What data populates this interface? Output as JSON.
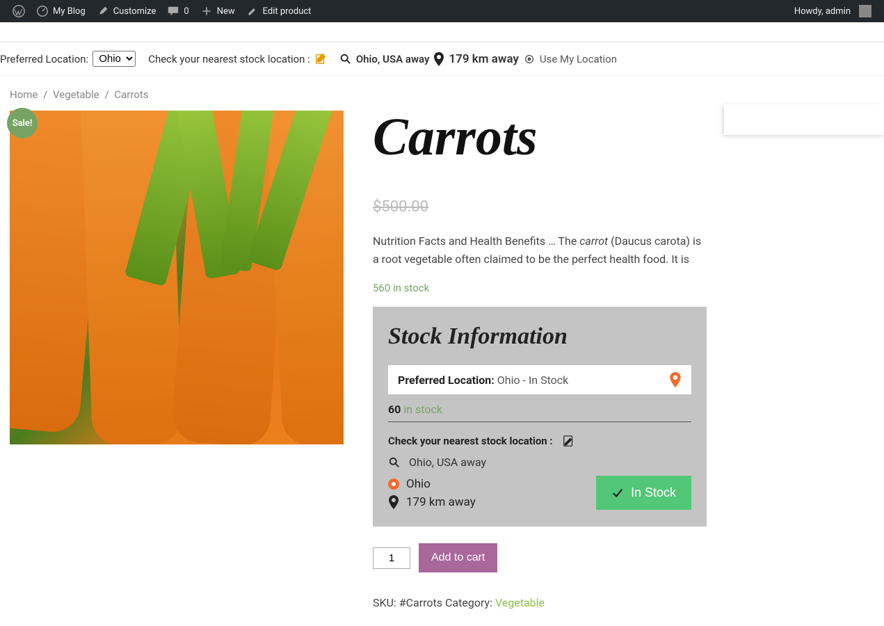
{
  "adminbar": {
    "site_name": "My Blog",
    "customize": "Customize",
    "comments_count": "0",
    "new": "New",
    "edit_product": "Edit product",
    "howdy": "Howdy, admin"
  },
  "location_strip": {
    "preferred_label": "Preferred Location:",
    "preferred_selected": "Ohio",
    "check_nearest": "Check your nearest stock location :",
    "loc_text": "Ohio, USA away",
    "distance": "179 km away",
    "use_my_location": "Use My Location"
  },
  "breadcrumb": {
    "home": "Home",
    "cat": "Vegetable",
    "current": "Carrots"
  },
  "product": {
    "sale_badge": "Sale!",
    "title": "Carrots",
    "price_old": "$500.00",
    "desc_prefix": "Nutrition Facts and Health Benefits … The ",
    "desc_em": "carrot",
    "desc_suffix": " (Daucus carota) is a root vegetable often claimed to be the perfect health food. It is",
    "stock_line": "560 in stock"
  },
  "stock_info": {
    "title": "Stock Information",
    "pref_label": "Preferred Location:",
    "pref_value": "Ohio - In Stock",
    "qty": "60",
    "qty_txt": "in stock",
    "check_nearest": "Check your nearest stock location :",
    "nearest_loc": "Ohio, USA away",
    "loc_name": "Ohio",
    "loc_dist": "179 km away",
    "instock_btn": "In Stock"
  },
  "cart": {
    "qty": "1",
    "add": "Add to cart"
  },
  "meta": {
    "sku_label": "SKU: ",
    "sku": "#Carrots",
    "cat_label": " Category: ",
    "cat": "Vegetable"
  }
}
